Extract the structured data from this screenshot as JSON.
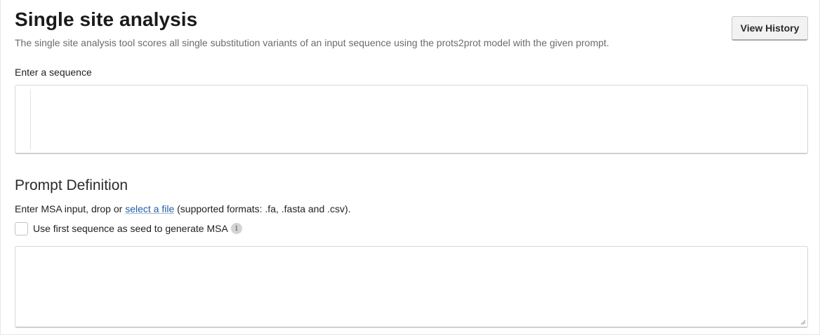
{
  "header": {
    "title": "Single site analysis",
    "subtitle": "The single site analysis tool scores all single substitution variants of an input sequence using the prots2prot model with the given prompt.",
    "history_button": "View History"
  },
  "sequence": {
    "label": "Enter a sequence",
    "value": ""
  },
  "prompt": {
    "heading": "Prompt Definition",
    "help_prefix": "Enter MSA input, drop or ",
    "help_link": "select a file",
    "help_suffix": " (supported formats: .fa, .fasta and .csv).",
    "seed_checkbox_label": "Use first sequence as seed to generate MSA",
    "seed_checked": false,
    "info_icon": "info-icon",
    "msa_value": ""
  },
  "colors": {
    "link": "#1f5fa8",
    "button_bg": "#f2f2f2",
    "border": "#d6d6d6"
  }
}
